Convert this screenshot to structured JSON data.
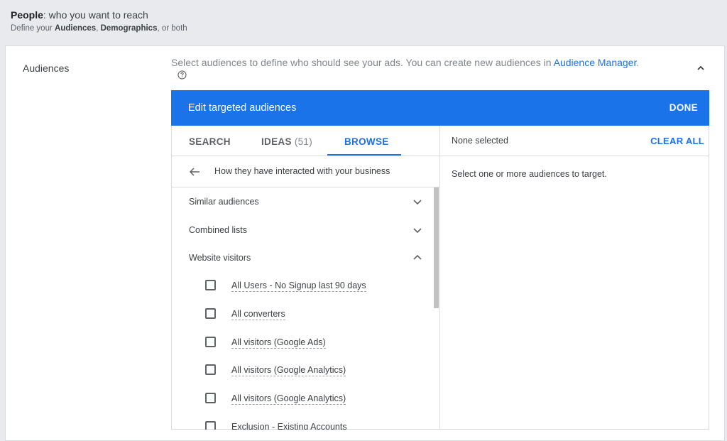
{
  "section": {
    "title_bold": "People",
    "title_rest": ": who you want to reach",
    "subtitle_pre": "Define your ",
    "subtitle_b1": "Audiences",
    "subtitle_mid": ", ",
    "subtitle_b2": "Demographics",
    "subtitle_post": ", or both"
  },
  "audiences": {
    "label": "Audiences",
    "description": "Select audiences to define who should see your ads.  You can create new audiences in ",
    "link": "Audience Manager",
    "description_end": "."
  },
  "panel": {
    "title": "Edit targeted audiences",
    "done_label": "DONE",
    "tabs": [
      {
        "label": "SEARCH"
      },
      {
        "label": "IDEAS",
        "count": "(51)"
      },
      {
        "label": "BROWSE"
      }
    ],
    "breadcrumb": "How they have interacted with your business",
    "categories": [
      {
        "label": "Similar audiences",
        "expanded": false
      },
      {
        "label": "Combined lists",
        "expanded": false
      },
      {
        "label": "Website visitors",
        "expanded": true
      }
    ],
    "items": [
      {
        "label": "All Users - No Signup last 90 days"
      },
      {
        "label": "All converters"
      },
      {
        "label": "All visitors (Google Ads)"
      },
      {
        "label": "All visitors (Google Analytics)"
      },
      {
        "label": "All visitors (Google Analytics)"
      },
      {
        "label": "Exclusion - Existing Accounts"
      }
    ],
    "selected_header": "None selected",
    "clear_all_label": "CLEAR ALL",
    "empty_message": "Select one or more audiences to target."
  },
  "colors": {
    "accent": "#1a73e8",
    "page_bg": "#e8eaed"
  }
}
